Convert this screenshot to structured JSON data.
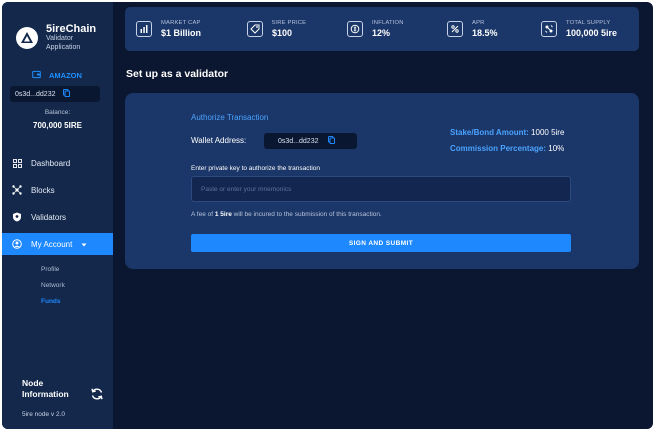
{
  "brand": {
    "name": "5ireChain",
    "subtitle_line1": "Validator",
    "subtitle_line2": "Application"
  },
  "sidebar": {
    "network": "AMAZON",
    "address": "0s3d...dd232",
    "balance_label": "Balance:",
    "balance_value": "700,000 5IRE",
    "nav": [
      {
        "label": "Dashboard",
        "icon": "grid-icon"
      },
      {
        "label": "Blocks",
        "icon": "blocks-icon"
      },
      {
        "label": "Validators",
        "icon": "shield-icon"
      },
      {
        "label": "My Account",
        "icon": "user-circle-icon",
        "active": true
      }
    ],
    "sub_nav": [
      {
        "label": "Profile"
      },
      {
        "label": "Network"
      },
      {
        "label": "Funds",
        "active": true
      }
    ],
    "node_info_title": "Node Information",
    "node_version": "5ire node v 2.0"
  },
  "stats": [
    {
      "label": "MARKET CAP",
      "value": "$1 Billion",
      "icon": "bar-chart-icon"
    },
    {
      "label": "5IRE PRICE",
      "value": "$100",
      "icon": "tag-icon"
    },
    {
      "label": "INFLATION",
      "value": "12%",
      "icon": "coin-icon"
    },
    {
      "label": "APR",
      "value": "18.5%",
      "icon": "percent-icon"
    },
    {
      "label": "TOTAL SUPPLY",
      "value": "100,000 5ire",
      "icon": "supply-icon"
    }
  ],
  "main": {
    "title": "Set up as a validator",
    "card": {
      "heading": "Authorize Transaction",
      "wallet_label": "Wallet Address:",
      "wallet_address": "0s3d...dd232",
      "stake_label": "Stake/Bond Amount:",
      "stake_value": "1000 5ire",
      "commission_label": "Commission Percentage:",
      "commission_value": "10%",
      "input_label": "Enter private key to authorize the transaction",
      "input_placeholder": "Paste or enter your mnemonics",
      "input_value": "",
      "fee_prefix": "A fee of ",
      "fee_amount": "1 5ire",
      "fee_suffix": " will be incured to the submission of this transaction.",
      "submit_label": "SIGN AND SUBMIT"
    }
  },
  "colors": {
    "accent": "#1e88ff",
    "background": "#0b1630",
    "panel": "#1b3668",
    "sidebar": "#13284b"
  }
}
